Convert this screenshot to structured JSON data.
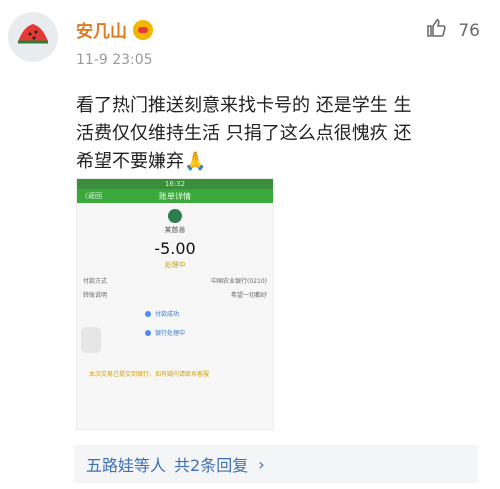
{
  "user": {
    "name": "安几山"
  },
  "post": {
    "time": "11-9 23:05",
    "likes": "76",
    "content_lines": [
      "看了热门推送刻意来找卡号的 还是学生 生",
      "活费仅仅维持生活 只捐了这么点很愧疚 还",
      "希望不要嫌弃🙏"
    ]
  },
  "screenshot": {
    "status_text": "16:32",
    "back": "〈返回",
    "title": "账单详情",
    "merchant": "某慈善",
    "amount": "-5.00",
    "state": "处理中",
    "rows": [
      {
        "k": "付款方式",
        "v": "中国农业银行(0210)"
      },
      {
        "k": "转账说明",
        "v": "希望一切都好"
      }
    ],
    "timeline": [
      "付款成功",
      "银行处理中"
    ],
    "note": "本次交易已提交到银行，如有疑问请联系客服"
  },
  "reply": {
    "who": "五路娃等人",
    "text": "共2条回复",
    "chevron": "›"
  }
}
